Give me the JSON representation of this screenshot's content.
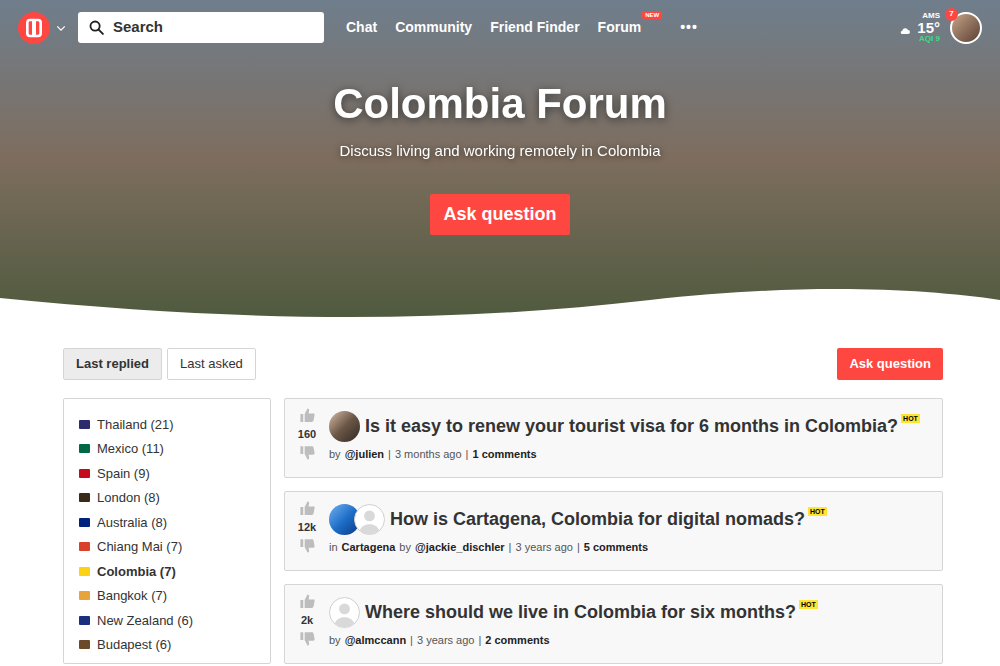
{
  "nav": {
    "search": {
      "placeholder": "Search"
    },
    "links": [
      {
        "label": "Chat"
      },
      {
        "label": "Community"
      },
      {
        "label": "Friend Finder"
      },
      {
        "label": "Forum",
        "badge": "NEW"
      }
    ],
    "more": "•••",
    "weather": {
      "city": "AMS",
      "temp": "15°",
      "aqi": "AQI 9"
    },
    "notifications": "7"
  },
  "hero": {
    "title": "Colombia Forum",
    "subtitle": "Discuss living and working remotely in Colombia",
    "button": "Ask question"
  },
  "sort_tabs": [
    {
      "label": "Last replied",
      "selected": true
    },
    {
      "label": "Last asked",
      "selected": false
    }
  ],
  "ask_button": "Ask question",
  "sidebar": {
    "items": [
      {
        "label": "Thailand (21)",
        "selected": false,
        "color": "#2d2a6e"
      },
      {
        "label": "Mexico (11)",
        "selected": false,
        "color": "#006847"
      },
      {
        "label": "Spain (9)",
        "selected": false,
        "color": "#c60b1e"
      },
      {
        "label": "London (8)",
        "selected": false,
        "color": "#3a2a1a"
      },
      {
        "label": "Australia (8)",
        "selected": false,
        "color": "#00247d"
      },
      {
        "label": "Chiang Mai (7)",
        "selected": false,
        "color": "#d9412b"
      },
      {
        "label": "Colombia (7)",
        "selected": true,
        "color": "#fcd116"
      },
      {
        "label": "Bangkok (7)",
        "selected": false,
        "color": "#e8a33a"
      },
      {
        "label": "New Zealand (6)",
        "selected": false,
        "color": "#1a2f7d"
      },
      {
        "label": "Budapest (6)",
        "selected": false,
        "color": "#6b4a2a"
      }
    ]
  },
  "posts": [
    {
      "title": "Is it easy to renew your tourist visa for 6 months in Colombia?",
      "votes": "160",
      "badge": "HOT",
      "avatars": [
        {
          "kind": "photo"
        }
      ],
      "meta": [
        {
          "text": "by",
          "bold": false
        },
        {
          "text": "@julien",
          "bold": true
        },
        {
          "text": "|",
          "bold": false
        },
        {
          "text": "3 months ago",
          "bold": false
        },
        {
          "text": "|",
          "bold": false
        },
        {
          "text": "1 comments",
          "bold": true
        }
      ]
    },
    {
      "title": "How is Cartagena, Colombia for digital nomads?",
      "votes": "12k",
      "badge": "HOT",
      "avatars": [
        {
          "kind": "globe"
        },
        {
          "kind": "placeholder"
        }
      ],
      "meta": [
        {
          "text": "in",
          "bold": false
        },
        {
          "text": "Cartagena",
          "bold": true
        },
        {
          "text": "by",
          "bold": false
        },
        {
          "text": "@jackie_dischler",
          "bold": true
        },
        {
          "text": "|",
          "bold": false
        },
        {
          "text": "3 years ago",
          "bold": false
        },
        {
          "text": "|",
          "bold": false
        },
        {
          "text": "5 comments",
          "bold": true
        }
      ]
    },
    {
      "title": "Where should we live in Colombia for six months?",
      "votes": "2k",
      "badge": "HOT",
      "avatars": [
        {
          "kind": "placeholder"
        }
      ],
      "meta": [
        {
          "text": "by",
          "bold": false
        },
        {
          "text": "@almccann",
          "bold": true
        },
        {
          "text": "|",
          "bold": false
        },
        {
          "text": "3 years ago",
          "bold": false
        },
        {
          "text": "|",
          "bold": false
        },
        {
          "text": "2 comments",
          "bold": true
        }
      ]
    }
  ]
}
